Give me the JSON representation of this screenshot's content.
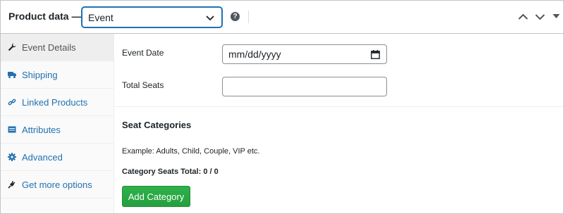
{
  "header": {
    "title": "Product data —",
    "product_type": "Event",
    "help_icon": "?"
  },
  "sidebar": {
    "items": [
      {
        "label": "Event Details",
        "icon": "wrench-icon",
        "active": true
      },
      {
        "label": "Shipping",
        "icon": "truck-icon",
        "active": false
      },
      {
        "label": "Linked Products",
        "icon": "link-icon",
        "active": false
      },
      {
        "label": "Attributes",
        "icon": "list-icon",
        "active": false
      },
      {
        "label": "Advanced",
        "icon": "gear-icon",
        "active": false
      },
      {
        "label": "Get more options",
        "icon": "plug-icon",
        "active": false
      }
    ]
  },
  "main": {
    "event_date_label": "Event Date",
    "event_date_placeholder": "mm/dd/yyyy",
    "total_seats_label": "Total Seats",
    "total_seats_value": "",
    "seat_categories_title": "Seat Categories",
    "example_text": "Example: Adults, Child, Couple, VIP etc.",
    "category_seats_total": "Category Seats Total: 0 / 0",
    "add_category_label": "Add Category"
  },
  "colors": {
    "link": "#2271b1",
    "button_green": "#2aa745",
    "border": "#c3c4c7"
  }
}
